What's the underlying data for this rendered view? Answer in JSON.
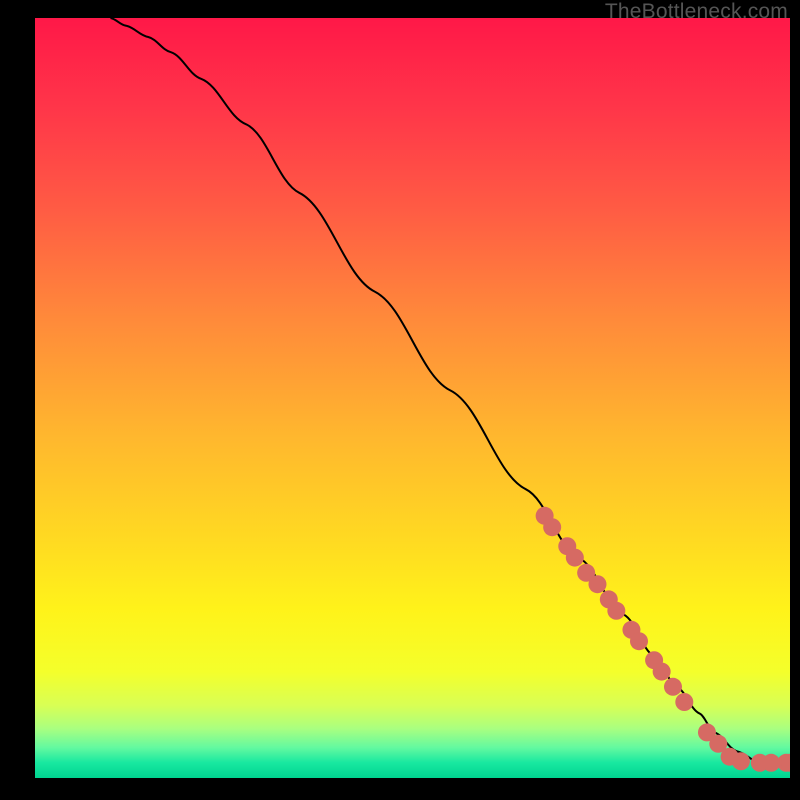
{
  "watermark": "TheBottleneck.com",
  "gradient_stops": [
    {
      "offset": 0.0,
      "color": "#ff1848"
    },
    {
      "offset": 0.12,
      "color": "#ff3649"
    },
    {
      "offset": 0.25,
      "color": "#ff5b44"
    },
    {
      "offset": 0.4,
      "color": "#ff8b3a"
    },
    {
      "offset": 0.55,
      "color": "#ffb72e"
    },
    {
      "offset": 0.68,
      "color": "#ffd822"
    },
    {
      "offset": 0.78,
      "color": "#fff31a"
    },
    {
      "offset": 0.86,
      "color": "#f4ff2b"
    },
    {
      "offset": 0.905,
      "color": "#d8ff55"
    },
    {
      "offset": 0.935,
      "color": "#a9ff80"
    },
    {
      "offset": 0.96,
      "color": "#63f9a0"
    },
    {
      "offset": 0.98,
      "color": "#18e8a0"
    },
    {
      "offset": 1.0,
      "color": "#00d490"
    }
  ],
  "chart_data": {
    "type": "line",
    "title": "",
    "xlabel": "",
    "ylabel": "",
    "xlim": [
      0,
      100
    ],
    "ylim": [
      0,
      100
    ],
    "series": [
      {
        "name": "curve",
        "x": [
          10,
          12,
          15,
          18,
          22,
          28,
          35,
          45,
          55,
          65,
          72,
          78,
          82,
          85,
          88,
          90,
          93,
          96,
          100
        ],
        "y": [
          100,
          99,
          97.5,
          95.5,
          92,
          86,
          77,
          64,
          51,
          38,
          29,
          21.5,
          16,
          12,
          8.5,
          6,
          3.5,
          2,
          2
        ]
      }
    ],
    "marker_color": "#d66a63",
    "markers_xy": [
      [
        67.5,
        34.5
      ],
      [
        68.5,
        33.0
      ],
      [
        70.5,
        30.5
      ],
      [
        71.5,
        29.0
      ],
      [
        73.0,
        27.0
      ],
      [
        74.5,
        25.5
      ],
      [
        76.0,
        23.5
      ],
      [
        77.0,
        22.0
      ],
      [
        79.0,
        19.5
      ],
      [
        80.0,
        18.0
      ],
      [
        82.0,
        15.5
      ],
      [
        83.0,
        14.0
      ],
      [
        84.5,
        12.0
      ],
      [
        86.0,
        10.0
      ],
      [
        89.0,
        6.0
      ],
      [
        90.5,
        4.5
      ],
      [
        92.0,
        2.8
      ],
      [
        93.5,
        2.2
      ],
      [
        96.0,
        2.0
      ],
      [
        97.5,
        2.0
      ],
      [
        99.5,
        2.0
      ],
      [
        100.0,
        2.0
      ]
    ]
  }
}
